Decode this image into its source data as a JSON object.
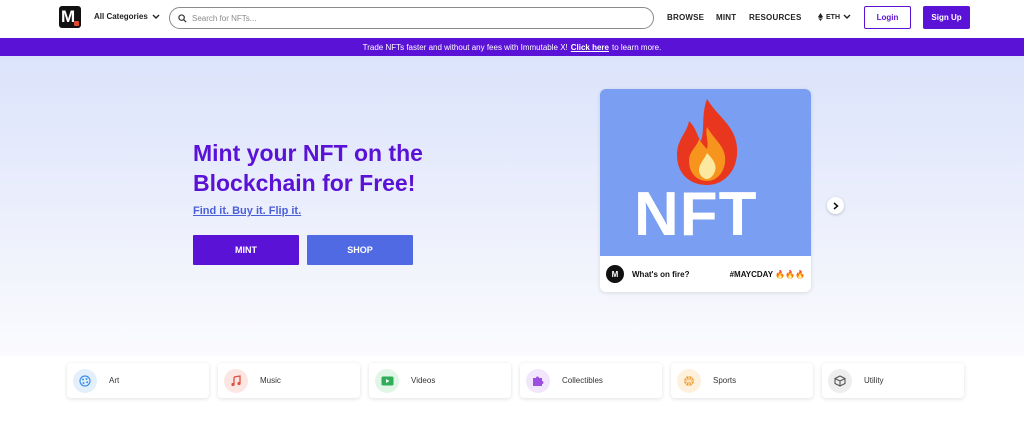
{
  "header": {
    "logo_letter": "M",
    "categories_label": "All Categories",
    "search_placeholder": "Search for NFTs...",
    "nav": [
      "BROWSE",
      "MINT",
      "RESOURCES"
    ],
    "network": "ETH",
    "login_label": "Login",
    "signup_label": "Sign Up"
  },
  "banner": {
    "text_before": "Trade NFTs faster and without any fees with Immutable X!",
    "link": "Click here",
    "text_after": "to learn more."
  },
  "hero": {
    "title": "Mint your NFT on the Blockchain for Free!",
    "subtitle": "Find it. Buy it. Flip it.",
    "mint_label": "MINT",
    "shop_label": "SHOP"
  },
  "featured_card": {
    "art_text": "NFT",
    "avatar_letter": "M",
    "label": "What's on fire?",
    "tag": "#MAYCDAY 🔥🔥🔥"
  },
  "categories": [
    {
      "label": "Art",
      "icon": "art-icon",
      "color": "#3f8fe6",
      "bg": "#e3f0fc"
    },
    {
      "label": "Music",
      "icon": "music-icon",
      "color": "#e0513e",
      "bg": "#fce6e3"
    },
    {
      "label": "Videos",
      "icon": "video-icon",
      "color": "#2fae5a",
      "bg": "#e2f6e8"
    },
    {
      "label": "Collectibles",
      "icon": "puzzle-icon",
      "color": "#9b4fe0",
      "bg": "#f1e6fc"
    },
    {
      "label": "Sports",
      "icon": "basketball-icon",
      "color": "#f0a23a",
      "bg": "#fdf1de"
    },
    {
      "label": "Utility",
      "icon": "cube-icon",
      "color": "#555555",
      "bg": "#eeeeee"
    }
  ],
  "colors": {
    "brand": "#5a12d6",
    "accent": "#4f6ae3"
  }
}
